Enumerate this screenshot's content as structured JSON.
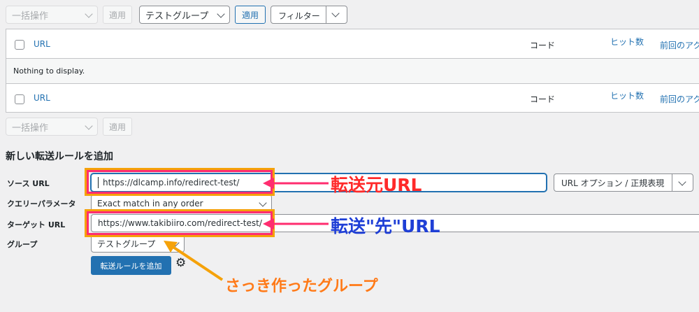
{
  "toolbar_top": {
    "bulk_action": "一括操作",
    "apply": "適用",
    "group_select": "テストグループ",
    "apply_group": "適用",
    "filter": "フィルター"
  },
  "table": {
    "columns": [
      "URL",
      "コード",
      "ヒット数",
      "前回のアク"
    ],
    "empty_message": "Nothing to display."
  },
  "toolbar_bottom": {
    "bulk_action": "一括操作",
    "apply": "適用"
  },
  "form": {
    "title": "新しい転送ルールを追加",
    "source_label": "ソース URL",
    "source_value": "https://dlcamp.info/redirect-test/",
    "url_options": "URL オプション / 正規表現",
    "query_label": "クエリーパラメータ",
    "query_value": "Exact match in any order",
    "target_label": "ターゲット URL",
    "target_value": "https://www.takibiiro.com/redirect-test/",
    "group_label": "グループ",
    "group_value": "テストグループ",
    "submit": "転送ルールを追加"
  },
  "annotations": {
    "source_note": "転送元URL",
    "target_note": "転送\"先\"URL",
    "group_note": "さっき作ったグループ"
  },
  "colors": {
    "accent": "#2271b1",
    "highlight_orange": "#f5a20a",
    "highlight_pink": "#ff2d6f",
    "note_red": "#ff2a2a",
    "note_blue": "#1f3fd6",
    "note_orange": "#ff7a18"
  }
}
